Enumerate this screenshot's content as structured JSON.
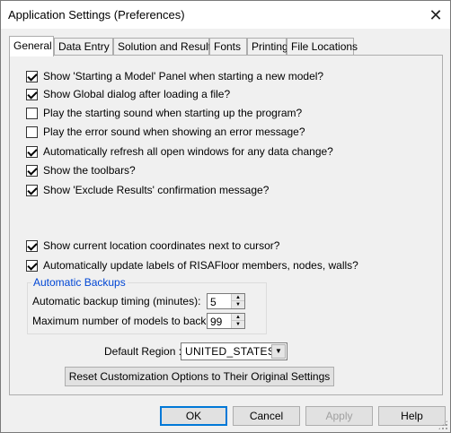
{
  "window": {
    "title": "Application Settings (Preferences)"
  },
  "tabs": [
    {
      "label": "General",
      "active": true
    },
    {
      "label": "Data Entry"
    },
    {
      "label": "Solution and Results"
    },
    {
      "label": "Fonts"
    },
    {
      "label": "Printing"
    },
    {
      "label": "File Locations"
    }
  ],
  "options": [
    {
      "label": "Show 'Starting a Model' Panel when starting a new model?",
      "checked": true
    },
    {
      "label": "Show Global dialog after loading a file?",
      "checked": true
    },
    {
      "label": "Play the starting sound when starting up the program?",
      "checked": false
    },
    {
      "label": "Play the error sound when showing an error message?",
      "checked": false
    },
    {
      "label": "Automatically refresh all open windows for any data change?",
      "checked": true
    },
    {
      "label": "Show the toolbars?",
      "checked": true
    },
    {
      "label": "Show 'Exclude Results' confirmation message?",
      "checked": true
    },
    {
      "label": "Show current location coordinates next to cursor?",
      "checked": true
    },
    {
      "label": "Automatically update labels of RISAFloor members, nodes, walls?",
      "checked": true
    }
  ],
  "backups": {
    "title": "Automatic Backups",
    "timing_label": "Automatic backup timing (minutes):",
    "timing_value": "5",
    "max_label": "Maximum number of models to backup:",
    "max_value": "99"
  },
  "region": {
    "label": "Default Region :",
    "value": "UNITED_STATES"
  },
  "reset_label": "Reset Customization Options to Their Original Settings",
  "buttons": {
    "ok": "OK",
    "cancel": "Cancel",
    "apply": "Apply",
    "help": "Help"
  }
}
